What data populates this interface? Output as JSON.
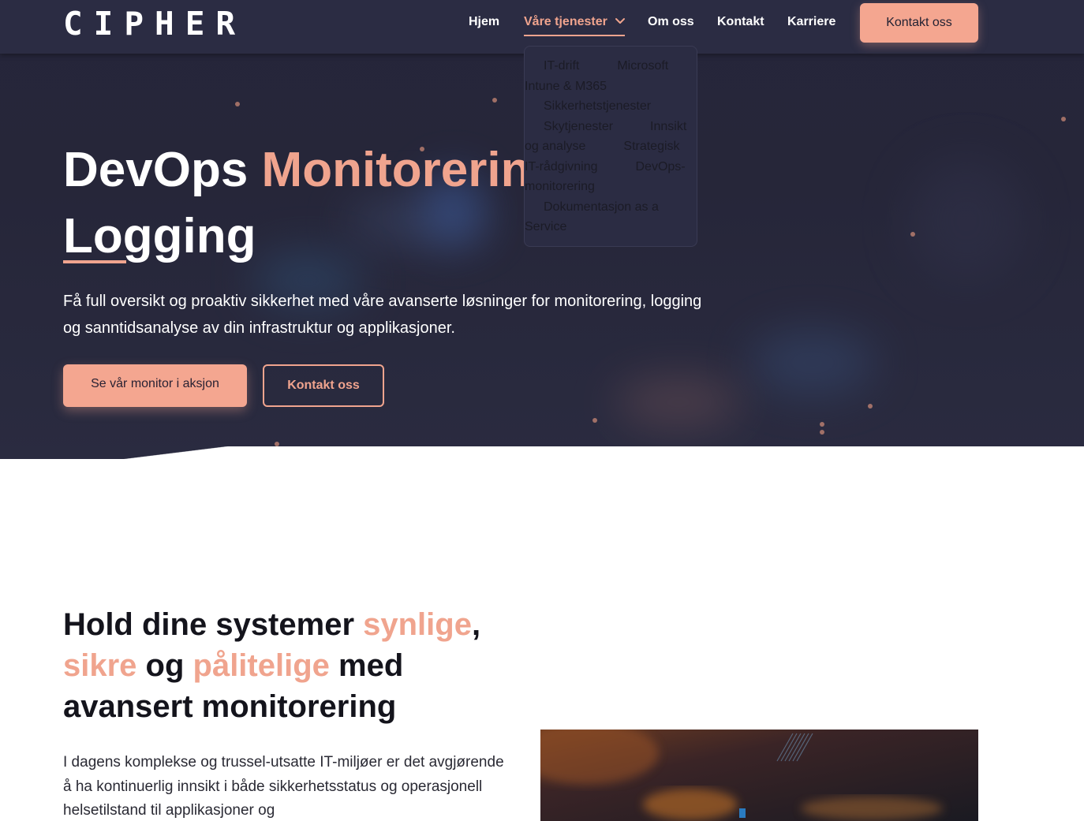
{
  "brand": {
    "logo": "CIPHER"
  },
  "nav": {
    "items": [
      "Hjem",
      "Våre tjenester",
      "Om oss",
      "Kontakt",
      "Karriere"
    ],
    "active": "Våre tjenester",
    "cta": "Kontakt oss"
  },
  "dropdown": {
    "items": [
      "IT-drift",
      "Microsoft Intune & M365",
      "Sikkerhetstjenester",
      "Skytjenester",
      "Innsikt og analyse",
      "Strategisk IT-rådgivning",
      "DevOps-monitorering",
      "Dokumentasjon as a Service"
    ]
  },
  "hero": {
    "title_part1": "DevOps ",
    "title_accent": "Monitorering",
    "title_part2": "Logging",
    "subtitle": "Få full oversikt og proaktiv sikkerhet med våre avanserte løsninger for monitorering, logging og sanntidsanalyse av din infrastruktur og applikasjoner.",
    "primary_button": "Se vår monitor i aksjon",
    "secondary_button": "Kontakt oss"
  },
  "section": {
    "title_1": "Hold dine systemer ",
    "title_accent_1": "synlige",
    "title_2": ",",
    "title_accent_2": "sikre",
    "title_3": " og ",
    "title_accent_3": "pålitelige",
    "title_4": " med avansert monitorering",
    "body": "I dagens komplekse og trussel-utsatte IT-miljøer er det avgjørende å ha kontinuerlig innsikt i både sikkerhetsstatus og operasjonell helsetilstand til applikasjoner og"
  },
  "colors": {
    "accent": "#f0a48e",
    "nav_bg": "#2b2c43",
    "hero_bg": "#25253a",
    "heading": "#14141c"
  }
}
